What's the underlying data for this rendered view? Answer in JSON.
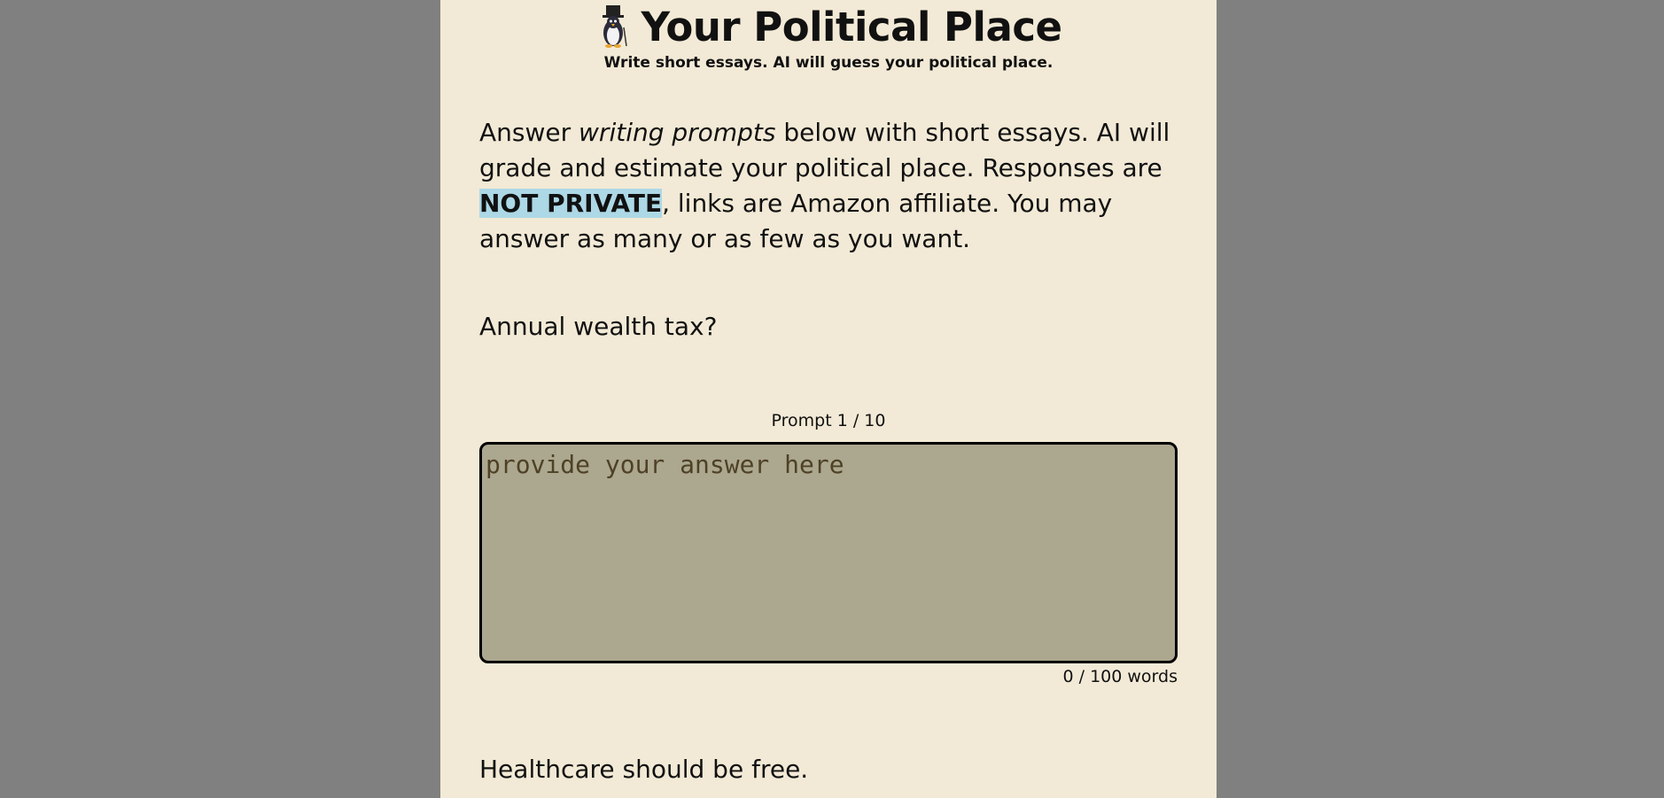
{
  "header": {
    "title": "Your Political Place",
    "subtitle": "Write short essays. AI will guess your political place.",
    "mascot_icon": "penguin-top-hat-icon"
  },
  "intro": {
    "part1": "Answer ",
    "emphasis": "writing prompts",
    "part2": " below with short essays. AI will grade and estimate your political place. Responses are ",
    "highlight": "NOT PRIVATE",
    "part3": ", links are Amazon affiliate. You may answer as many or as few as you want.",
    "highlight_color": "#add8e6"
  },
  "prompts": [
    {
      "text": "Annual wealth tax?",
      "counter": "Prompt 1 / 10",
      "answer_value": "",
      "placeholder": "provide your answer here",
      "word_count": "0 / 100 words"
    },
    {
      "text": "Healthcare should be free."
    }
  ],
  "colors": {
    "page_background": "#808080",
    "column_background": "#f2ead6",
    "textarea_background": "#aca78f"
  }
}
